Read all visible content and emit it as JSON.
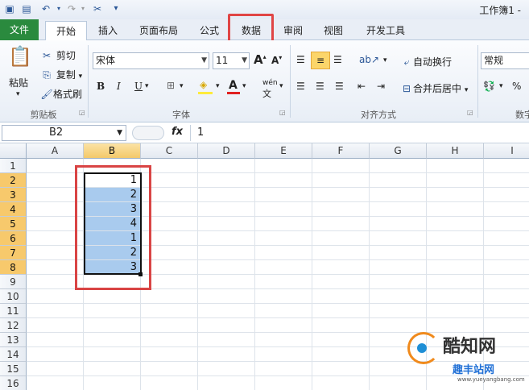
{
  "titlebar": {
    "title": "工作簿1 -"
  },
  "tabs": [
    "文件",
    "开始",
    "插入",
    "页面布局",
    "公式",
    "数据",
    "审阅",
    "视图",
    "开发工具"
  ],
  "clipboard": {
    "paste": "粘贴",
    "cut": "剪切",
    "copy": "复制",
    "format_painter": "格式刷",
    "label": "剪贴板"
  },
  "font": {
    "name": "宋体",
    "size": "11",
    "bold": "B",
    "italic": "I",
    "underline": "U",
    "color_letter": "A",
    "phonetic": "wén",
    "label": "字体"
  },
  "align": {
    "wrap": "自动换行",
    "merge": "合并后居中",
    "label": "对齐方式"
  },
  "number": {
    "format": "常规",
    "percent": "%",
    "label": "数字"
  },
  "formula": {
    "name_box": "B2",
    "fx": "fx",
    "value": "1"
  },
  "columns": [
    "A",
    "B",
    "C",
    "D",
    "E",
    "F",
    "G",
    "H",
    "I"
  ],
  "rows": [
    "1",
    "2",
    "3",
    "4",
    "5",
    "6",
    "7",
    "8",
    "9",
    "10",
    "11",
    "12",
    "13",
    "14",
    "15",
    "16"
  ],
  "cells_b": [
    "1",
    "2",
    "3",
    "4",
    "1",
    "2",
    "3"
  ],
  "watermark": {
    "brand": "酷知网",
    "sub": "趣丰站网",
    "url": "www.yueyangbang.com"
  },
  "colors": {
    "file_tab": "#2a8a3e",
    "highlight": "#e04545",
    "selection": "#a9cbee",
    "header_sel": "#f4c96a"
  }
}
